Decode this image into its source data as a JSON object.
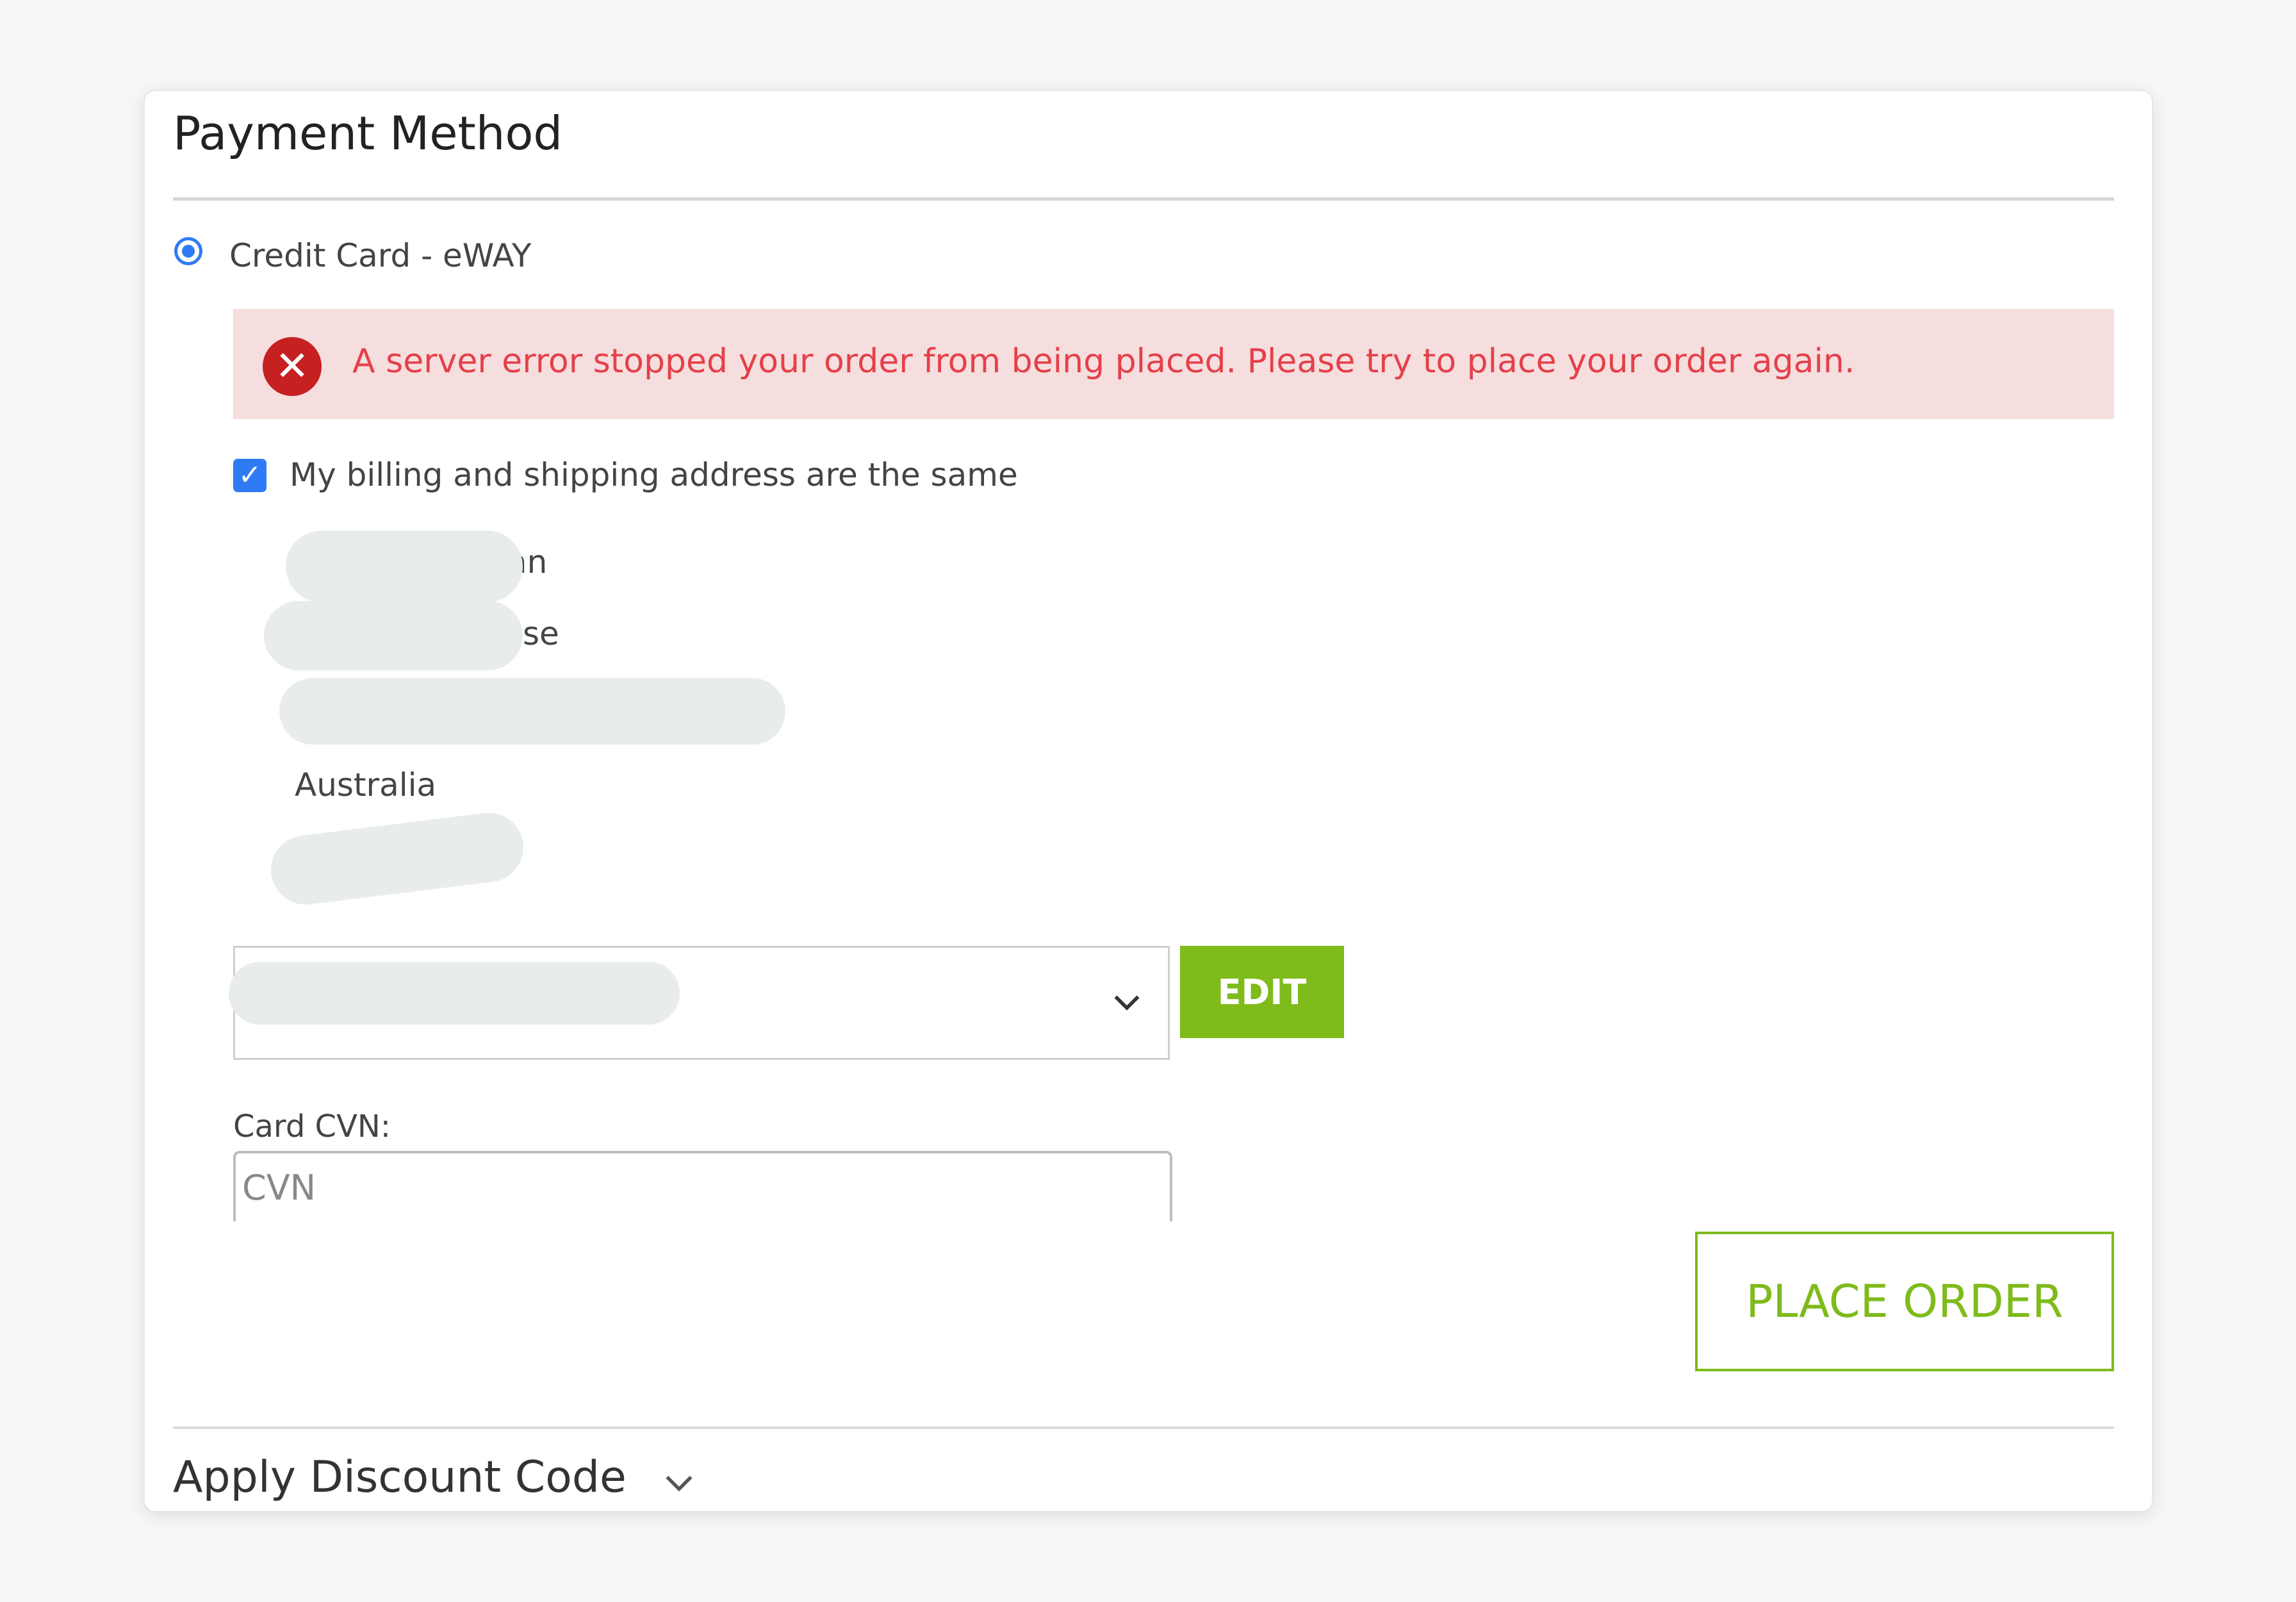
{
  "payment": {
    "title": "Payment Method",
    "method_label": "Credit Card - eWAY",
    "error_message": "A server error stopped your order from being placed. Please try to place your order again.",
    "billing_same_label": "My billing and shipping address are the same",
    "billing_same_checked": true,
    "address": {
      "name_fragment": "an",
      "street_fragment": "se",
      "country": "Australia"
    },
    "saved_card_select": {
      "selected_value": ""
    },
    "edit_label": "EDIT",
    "cvn": {
      "label": "Card CVN:",
      "placeholder": "CVN"
    },
    "place_order_label": "PLACE ORDER"
  },
  "discount": {
    "label": "Apply Discount Code"
  },
  "icons": {
    "error": "error-x-icon",
    "chevron": "chevron-down-icon",
    "check": "checkmark-icon"
  },
  "colors": {
    "accent_green": "#7ebb1b",
    "accent_blue": "#2f7bf5",
    "error_red": "#e5404a",
    "error_background": "#f6dede"
  }
}
